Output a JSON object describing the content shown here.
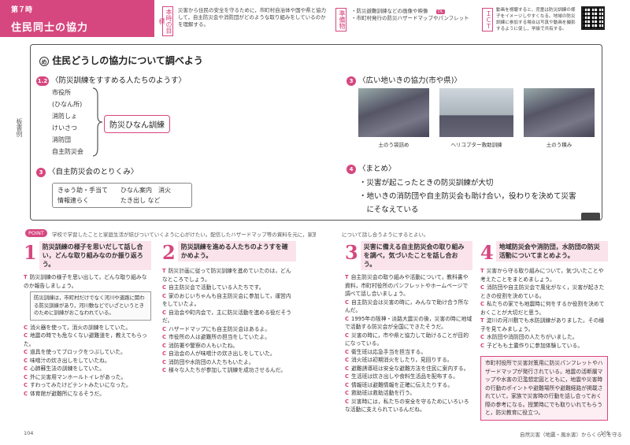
{
  "header": {
    "lesson_no": "第７時",
    "lesson_title": "住民同士の協力",
    "aim_label": "本時の目標",
    "aim_text": "災害から住民の安全を守るために，市町村自治体や国や県と協力して，自主防災会や消防団がどのような取り組みをしているのかを理解する。",
    "prep_label": "準備物",
    "prep_items": [
      "・防災避難訓練などの画像や映像",
      "・市町村発行の防災ハザードマップやパンフレット"
    ],
    "ict_label": "ＩＣＴ",
    "ict_text": "動画を視聴すると，児童は防災訓練の様子をイメージしやすくなる。地域の防災訓練に参加する場合は写真や動画を撮影するように促し，学級で共有する。",
    "dl_badge1": "DL",
    "dl_badge2": "DL"
  },
  "board": {
    "side_label": "板書例",
    "main_title": "住民どうしの協力について調べよう",
    "title_mark": "め",
    "s12_num": "1.2",
    "s12_title": "〈防災訓練をすすめる人たちのようす〉",
    "s12_items": [
      "市役所",
      "(ひなん所)",
      "消防しょ",
      "けいさつ",
      "消防団",
      "自主防災会"
    ],
    "s12_box": "防災ひなん訓練",
    "s3a_num": "3",
    "s3a_title": "〈自主防災会のとりくみ〉",
    "s3a_row1": "きゅう助・手当て　　ひなん案内　消火",
    "s3a_row2": "情報連らく　　　　　たき出し など",
    "s3b_num": "3",
    "s3b_title": "〈広い地いきの協力(市や県)〉",
    "photos": [
      "土のう袋詰め",
      "ヘリコプター救助訓練",
      "土のう積み"
    ],
    "photo_badge": "DL",
    "s4_num": "4",
    "s4_title": "〈まとめ〉",
    "s4_items": [
      "・災害が起こったときの防災訓練が大切",
      "・地いきの消防団や自主防災会も助け合い，役わりを決めて災害",
      "　にそなえている"
    ]
  },
  "point": {
    "label": "POINT",
    "text": "学校で学習したことと家庭生活が結びついていくように心がけたい。配信したハザードマップ等の資料を元に，家族で防災",
    "text2": "について話し合うようにするとよい。"
  },
  "columns": [
    {
      "num": "1",
      "head": "防災訓練の様子を思いだして話し合い，どんな取り組みなのか振り返ろう。",
      "paras": [
        {
          "k": "T",
          "t": "防災訓練の様子を思い出して，どんな取り組みなのか報告しましょう。"
        },
        {
          "k": "",
          "t": "防災訓練は，市町村だけでなく河川や道路に関わる防災訓練があり，河川敷などでいざというときのために訓練がおこなわれている。",
          "note": true
        },
        {
          "k": "C",
          "t": "消火器を使って，消火の訓練をしていた。"
        },
        {
          "k": "C",
          "t": "地震の時でも危なくない避難道を，教えてもらった。"
        },
        {
          "k": "C",
          "t": "道具を使ってブロックをつぶしていた。"
        },
        {
          "k": "C",
          "t": "味噌汁の炊き出しをしていたね。"
        },
        {
          "k": "C",
          "t": "心肺蘇生法の訓練をしていた。"
        },
        {
          "k": "C",
          "t": "外に災害用マンホールトイレがあった。"
        },
        {
          "k": "C",
          "t": "すわってみたけどテントみたいになった。"
        },
        {
          "k": "C",
          "t": "体育館が避難所になるそうだ。"
        }
      ]
    },
    {
      "num": "2",
      "head": "防災訓練を進める人たちのようすを確かめよう。",
      "paras": [
        {
          "k": "T",
          "t": "防災計画に従って防災訓練を進めていたのは，どんなところでしょう。"
        },
        {
          "k": "C",
          "t": "自主防災会で活動している人たちです。"
        },
        {
          "k": "C",
          "t": "家のおじいちゃんも自主防災会に参加して，運営内をしていたよ。"
        },
        {
          "k": "C",
          "t": "自治会や町内会で，主に防災活動を進める役だそうだ。"
        },
        {
          "k": "C",
          "t": "ハザードマップにも自主防災会はあるよ。"
        },
        {
          "k": "C",
          "t": "市役所の人は避難所の担当をしていたよ。"
        },
        {
          "k": "C",
          "t": "消防署や警察の人もいたね。"
        },
        {
          "k": "C",
          "t": "自治会の人が味噌汁の炊き出しをしていた。"
        },
        {
          "k": "C",
          "t": "消防団や水防団の人たちもいたよ。"
        },
        {
          "k": "C",
          "t": "様々な人たちが参加して訓練を成功させるんだ。"
        }
      ]
    },
    {
      "num": "3",
      "head": "災害に備える自主防災会の取り組みを調べ，気づいたことを話し合おう。",
      "paras": [
        {
          "k": "T",
          "t": "自主防災会の取り組みや活動について，教科書や資料，市町村役所のパンフレットやホームページで調べて話し合いましょう。"
        },
        {
          "k": "C",
          "t": "自主防災会は災害の時に，みんなで助け合う所なんだ。"
        },
        {
          "k": "C",
          "t": "1995年の阪神・淡路大震災の後，災害の時に地域で活動する防災会が全国にできたそうだ。"
        },
        {
          "k": "C",
          "t": "災害の時に，市や県と協力して助けることが目的になっている。"
        },
        {
          "k": "C",
          "t": "衛生班は応急手当を担当する。"
        },
        {
          "k": "C",
          "t": "消火班は初期消火をしたり，見回りする。"
        },
        {
          "k": "C",
          "t": "避難誘導班は安全な避難方法を住民に案内する。"
        },
        {
          "k": "C",
          "t": "生活班は炊き出しや食料生活品を配布する。"
        },
        {
          "k": "C",
          "t": "情報班は避難情報を正確に伝えたりする。"
        },
        {
          "k": "C",
          "t": "救助班は救助活動を行う。"
        },
        {
          "k": "C",
          "t": "災害時には，私たちの安全を守るためにいろいろな活動に支えられているんだね。"
        }
      ]
    },
    {
      "num": "4",
      "head": "地域防災会や消防団，水防団の防災活動についてまとめよう。",
      "paras": [
        {
          "k": "T",
          "t": "災害から守る取り組みについて，気づいたことや考えたことをまとめましょう。"
        },
        {
          "k": "C",
          "t": "消防団や自主防災会で風化がなく，災害が起きたときの役割を決めている。"
        },
        {
          "k": "C",
          "t": "私たちの家でも地震時に何をするか役割を決めておくことが大切だと思う。"
        },
        {
          "k": "T",
          "t": "淀川の河川敷でも水防訓練がありました。その様子を見てみましょう。"
        },
        {
          "k": "C",
          "t": "水防団や消防団の人たちがいました。"
        },
        {
          "k": "C",
          "t": "子どもも土嚢作りに参加体験している。"
        }
      ],
      "summary": "市町村役所で災害対策用に防災パンフレットやハザードマップが発行されている。地震の活断層マップや水害の氾濫想定図とともに，地震や災害時の行動のポイントや避難場所や避難経路が掲載されていて，家族で災害時の行動を話し合っておく際の参考になる。授業時にでも取りいれてもらうと，防災教育に役立つ。"
    }
  ],
  "footer": {
    "left_page": "104",
    "right_title": "自然災害（地震・風水害）からくらしを守る",
    "right_page": "105"
  },
  "colors": {
    "accent": "#d6477f"
  }
}
